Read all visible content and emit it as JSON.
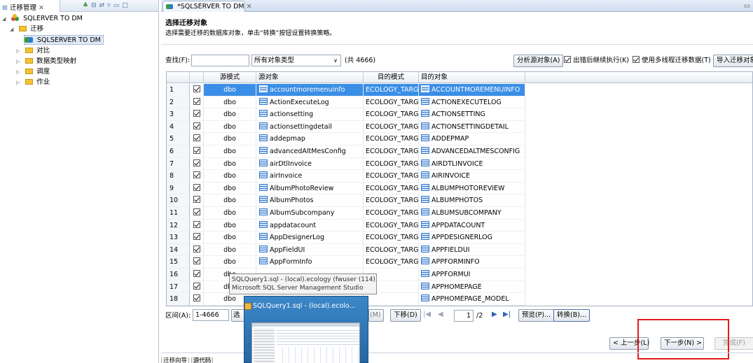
{
  "left_panel": {
    "tab_label": "迁移管理",
    "tree": [
      {
        "label": "SQLERVER TO DM",
        "level": 0,
        "icon": "db-project-icon"
      },
      {
        "label": "迁移",
        "level": 1,
        "icon": "folder-icon"
      },
      {
        "label": "SQLSERVER  TO DM",
        "level": 2,
        "icon": "migration-icon"
      },
      {
        "label": "对比",
        "level": 1,
        "icon": "folder-icon"
      },
      {
        "label": "数据类型映射",
        "level": 1,
        "icon": "folder-icon"
      },
      {
        "label": "调度",
        "level": 1,
        "icon": "folder-icon"
      },
      {
        "label": "作业",
        "level": 1,
        "icon": "folder-icon"
      }
    ]
  },
  "editor": {
    "tab_label": "*SQLSERVER  TO DM",
    "title": "选择迁移对象",
    "description": "选择需要迁移的数据库对象，单击“转换”按钮设置转换策略。",
    "filter": {
      "search_label": "查找(F):",
      "search_value": "",
      "type_select": "所有对象类型",
      "count": "(共 4666)",
      "analyze_button": "分析源对象(A)",
      "continue_on_error": "出错后继续执行(K)",
      "multithread": "使用多线程迁移数据(T)",
      "import_button": "导入迁移对象"
    },
    "columns": [
      "源模式",
      "源对象",
      "目的模式",
      "目的对象"
    ],
    "rows": [
      {
        "n": "1",
        "schema": "dbo",
        "src": "accountmoremenuinfo",
        "dschema": "ECOLOGY_TARG",
        "dst": "ACCOUNTMOREMENUINFO"
      },
      {
        "n": "2",
        "schema": "dbo",
        "src": "ActionExecuteLog",
        "dschema": "ECOLOGY_TARG",
        "dst": "ACTIONEXECUTELOG"
      },
      {
        "n": "3",
        "schema": "dbo",
        "src": "actionsetting",
        "dschema": "ECOLOGY_TARG",
        "dst": "ACTIONSETTING"
      },
      {
        "n": "4",
        "schema": "dbo",
        "src": "actionsettingdetail",
        "dschema": "ECOLOGY_TARG",
        "dst": "ACTIONSETTINGDETAIL"
      },
      {
        "n": "5",
        "schema": "dbo",
        "src": "addepmap",
        "dschema": "ECOLOGY_TARG",
        "dst": "ADDEPMAP"
      },
      {
        "n": "6",
        "schema": "dbo",
        "src": "advancedAltMesConfig",
        "dschema": "ECOLOGY_TARG",
        "dst": "ADVANCEDALTMESCONFIG"
      },
      {
        "n": "7",
        "schema": "dbo",
        "src": "airDtlInvoice",
        "dschema": "ECOLOGY_TARG",
        "dst": "AIRDTLINVOICE"
      },
      {
        "n": "8",
        "schema": "dbo",
        "src": "airInvoice",
        "dschema": "ECOLOGY_TARG",
        "dst": "AIRINVOICE"
      },
      {
        "n": "9",
        "schema": "dbo",
        "src": "AlbumPhotoReview",
        "dschema": "ECOLOGY_TARG",
        "dst": "ALBUMPHOTOREVIEW"
      },
      {
        "n": "10",
        "schema": "dbo",
        "src": "AlbumPhotos",
        "dschema": "ECOLOGY_TARG",
        "dst": "ALBUMPHOTOS"
      },
      {
        "n": "11",
        "schema": "dbo",
        "src": "AlbumSubcompany",
        "dschema": "ECOLOGY_TARG",
        "dst": "ALBUMSUBCOMPANY"
      },
      {
        "n": "12",
        "schema": "dbo",
        "src": "appdatacount",
        "dschema": "ECOLOGY_TARG",
        "dst": "APPDATACOUNT"
      },
      {
        "n": "13",
        "schema": "dbo",
        "src": "AppDesignerLog",
        "dschema": "ECOLOGY_TARG",
        "dst": "APPDESIGNERLOG"
      },
      {
        "n": "14",
        "schema": "dbo",
        "src": "AppFieldUI",
        "dschema": "ECOLOGY_TARG",
        "dst": "APPFIELDUI"
      },
      {
        "n": "15",
        "schema": "dbo",
        "src": "AppFormInfo",
        "dschema": "ECOLOGY_TARG",
        "dst": "APPFORMINFO"
      },
      {
        "n": "16",
        "schema": "dbo",
        "src": "",
        "dschema": "",
        "dst": "APPFORMUI"
      },
      {
        "n": "17",
        "schema": "dbo",
        "src": "",
        "dschema": "",
        "dst": "APPHOMEPAGE"
      },
      {
        "n": "18",
        "schema": "dbo",
        "src": "",
        "dschema": "",
        "dst": "APPHOMEPAGE_MODEL"
      }
    ],
    "range": {
      "label": "区间(A):",
      "value": "1-4666",
      "select_btn": "选",
      "up_btn": "(M)",
      "down_btn": "下移(D)",
      "page_current": "1",
      "page_total": "/2",
      "preview_btn": "预览(P)...",
      "convert_btn": "转换(B)..."
    },
    "footer": {
      "prev_button": "< 上一步(L)",
      "next_button": "下一步(N) >",
      "finish_button": "完成(F)"
    },
    "bottom_tabs": [
      "迁移向导",
      "源代码"
    ]
  },
  "taskbar_preview": {
    "tooltip_line1": "SQLQuery1.sql - (local).ecology (fwuser (114))* -",
    "tooltip_line2": "Microsoft SQL Server Management Studio",
    "title": "SQLQuery1.sql - (local).ecolo..."
  }
}
